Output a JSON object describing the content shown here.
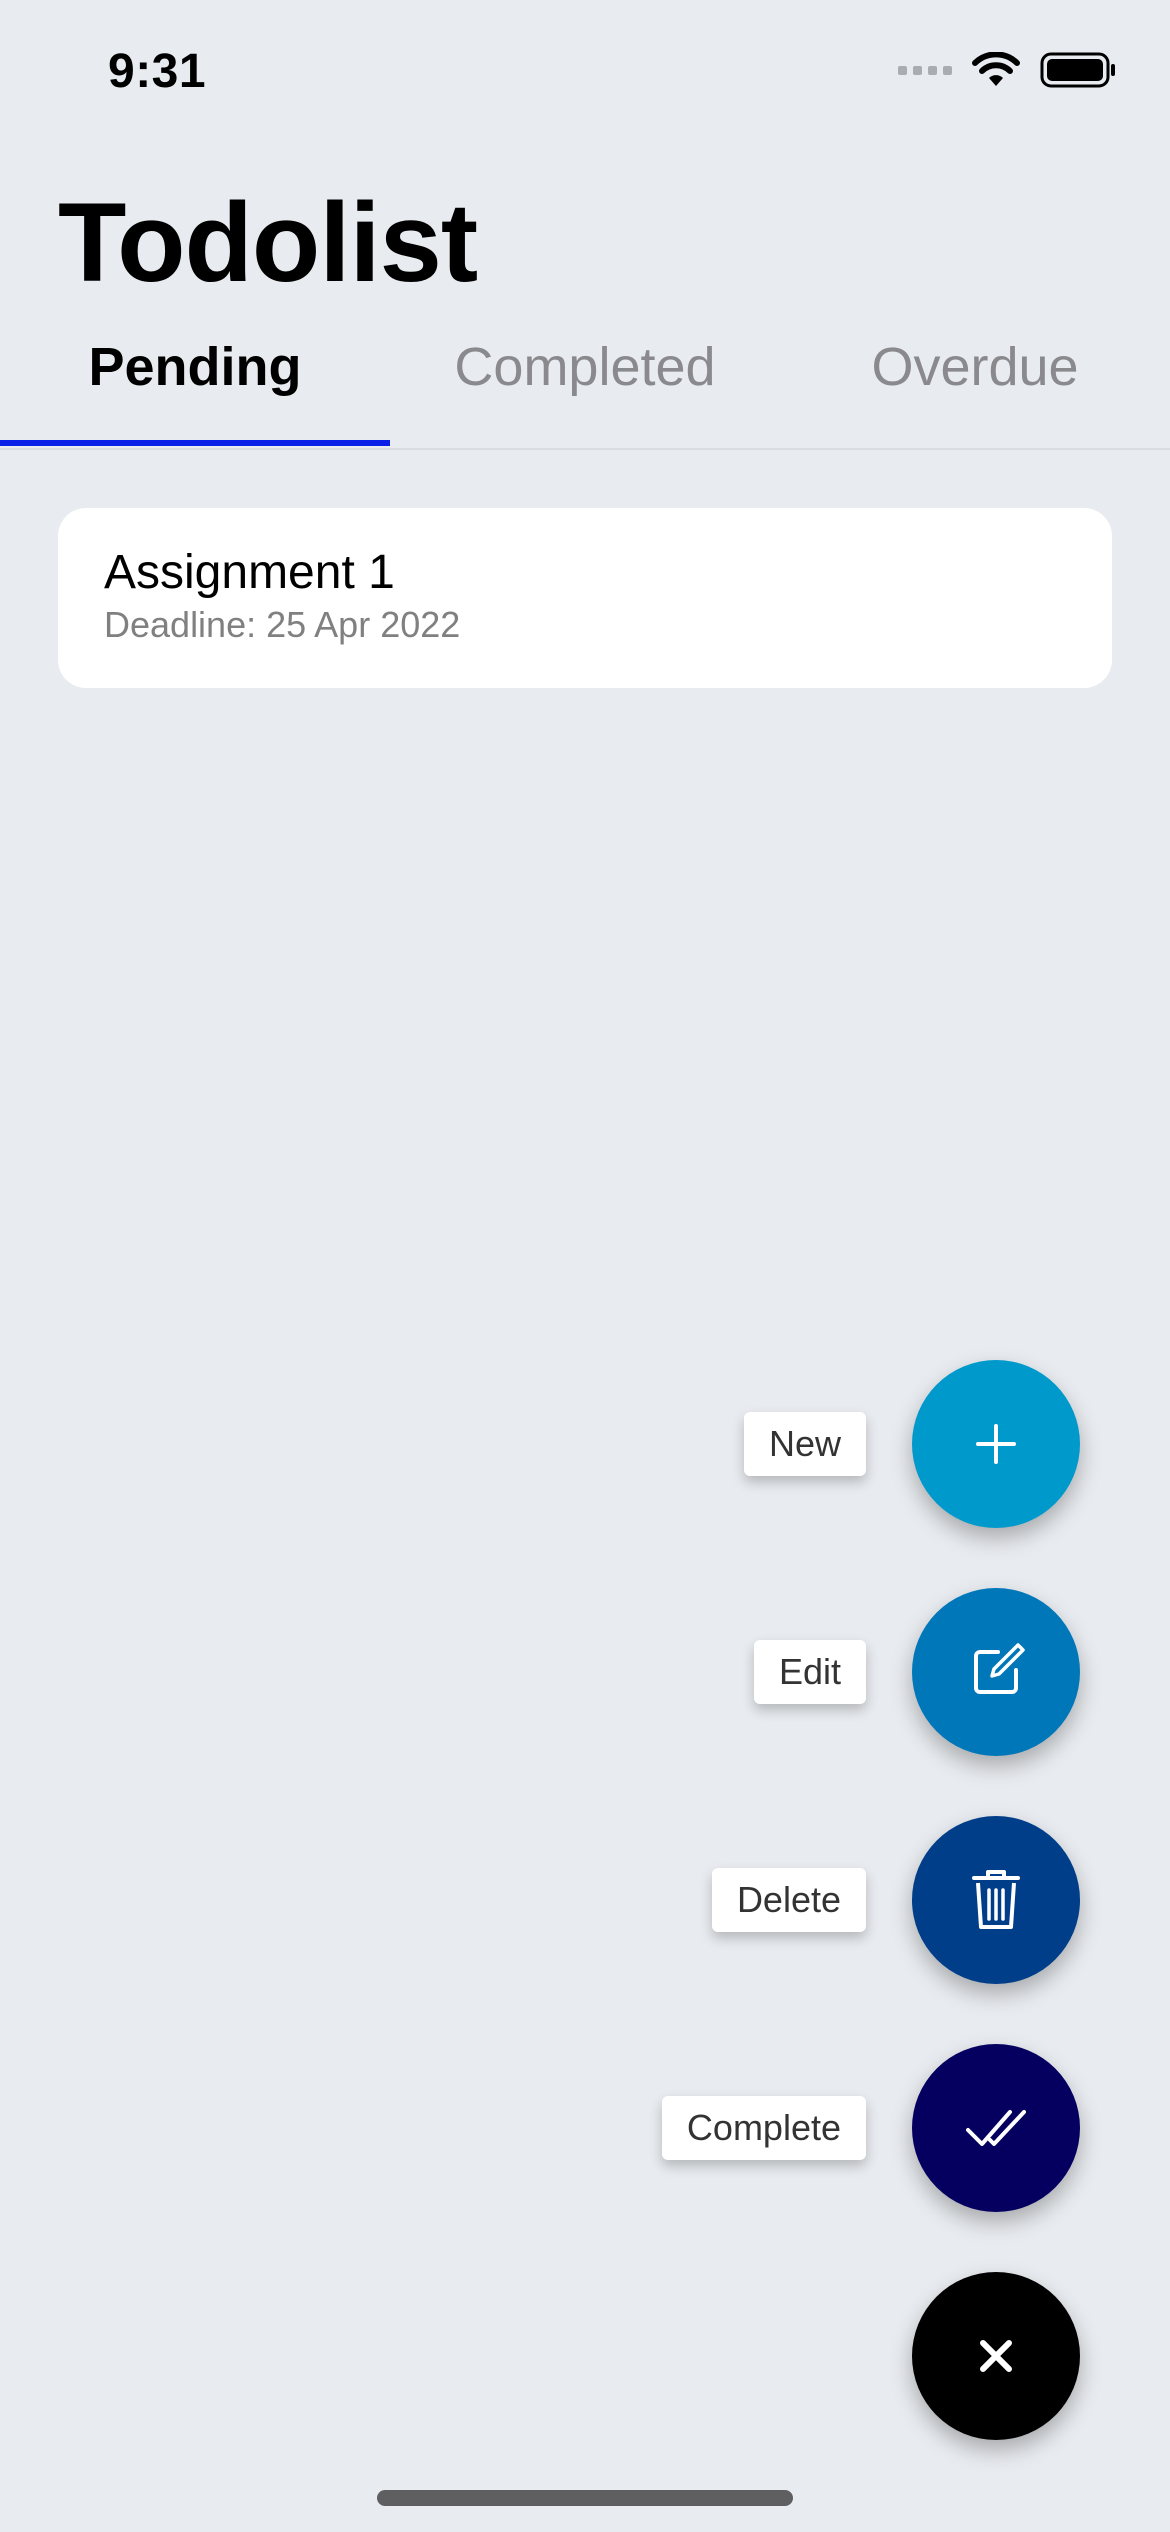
{
  "status_bar": {
    "time": "9:31"
  },
  "header": {
    "title": "Todolist"
  },
  "tabs": [
    {
      "label": "Pending",
      "active": true
    },
    {
      "label": "Completed",
      "active": false
    },
    {
      "label": "Overdue",
      "active": false
    }
  ],
  "tasks": [
    {
      "title": "Assignment 1",
      "deadline": "Deadline: 25 Apr 2022"
    }
  ],
  "fab_menu": {
    "actions": [
      {
        "label": "New",
        "icon": "plus-icon",
        "color": "#0099cc"
      },
      {
        "label": "Edit",
        "icon": "edit-icon",
        "color": "#0077b8"
      },
      {
        "label": "Delete",
        "icon": "trash-icon",
        "color": "#003e8a"
      },
      {
        "label": "Complete",
        "icon": "double-check-icon",
        "color": "#05005f"
      }
    ],
    "close": {
      "icon": "close-icon",
      "color": "#000000"
    }
  },
  "colors": {
    "accent": "#0a20e6",
    "background": "#e8ebef"
  }
}
